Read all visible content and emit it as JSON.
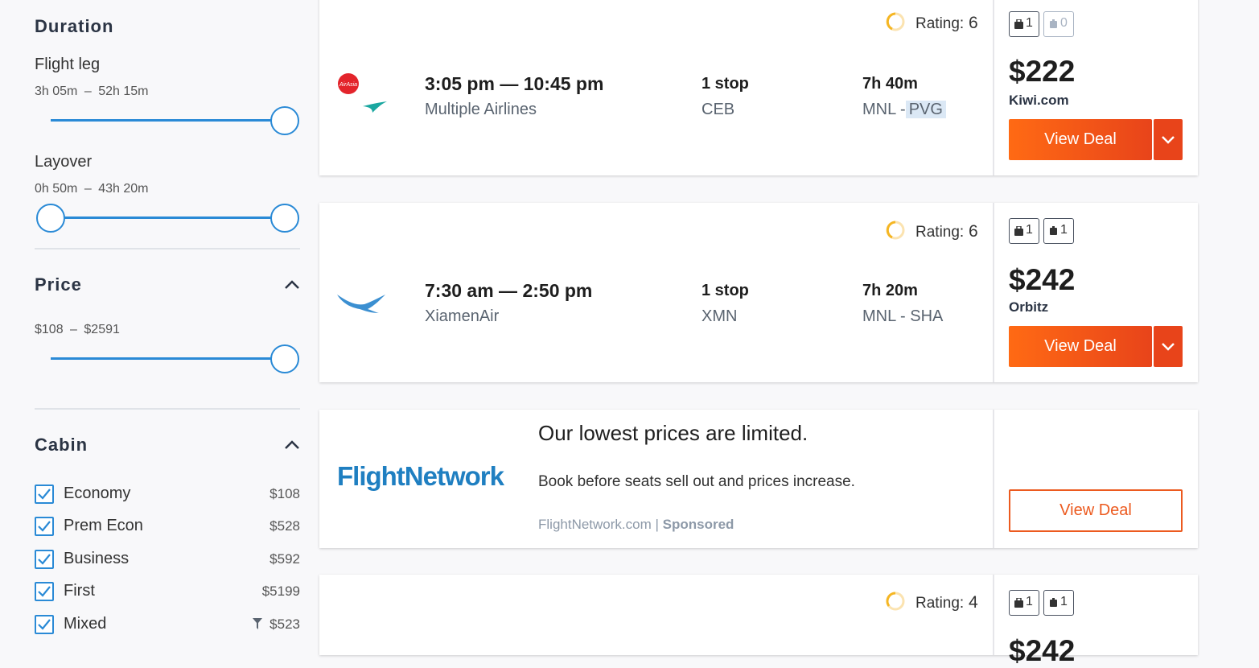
{
  "sidebar": {
    "duration": {
      "title": "Duration",
      "flight_leg": {
        "label": "Flight leg",
        "min": "3h 05m",
        "sep": "–",
        "max": "52h 15m"
      },
      "layover": {
        "label": "Layover",
        "min": "0h 50m",
        "sep": "–",
        "max": "43h 20m"
      }
    },
    "price": {
      "title": "Price",
      "min": "$108",
      "sep": "–",
      "max": "$2591"
    },
    "cabin": {
      "title": "Cabin",
      "options": [
        {
          "label": "Economy",
          "price": "$108",
          "checked": true
        },
        {
          "label": "Prem Econ",
          "price": "$528",
          "checked": true
        },
        {
          "label": "Business",
          "price": "$592",
          "checked": true
        },
        {
          "label": "First",
          "price": "$5199",
          "checked": true
        },
        {
          "label": "Mixed",
          "price": "$523",
          "checked": true
        }
      ]
    }
  },
  "results": [
    {
      "rating_label": "Rating:",
      "rating": "6",
      "times": "3:05 pm — 10:45 pm",
      "airline": "Multiple Airlines",
      "stops": "1 stop",
      "stop_code": "CEB",
      "duration": "7h 40m",
      "route_from": "MNL -",
      "route_to": "PVG",
      "bags": {
        "carry": "1",
        "checked": "0"
      },
      "price": "$222",
      "provider": "Kiwi.com",
      "deal_label": "View Deal",
      "logo_text": "AirAsia"
    },
    {
      "rating_label": "Rating:",
      "rating": "6",
      "times": "7:30 am — 2:50 pm",
      "airline": "XiamenAir",
      "stops": "1 stop",
      "stop_code": "XMN",
      "duration": "7h 20m",
      "route": "MNL - SHA",
      "bags": {
        "carry": "1",
        "checked": "1"
      },
      "price": "$242",
      "provider": "Orbitz",
      "deal_label": "View Deal"
    },
    {
      "rating_label": "Rating:",
      "rating": "4",
      "bags": {
        "carry": "1",
        "checked": "1"
      },
      "price": "$242"
    }
  ],
  "ad": {
    "logo": "FlightNetwork",
    "title": "Our lowest prices are limited.",
    "text": "Book before seats sell out and prices increase.",
    "source": "FlightNetwork.com |",
    "sponsored": "Sponsored",
    "deal_label": "View Deal"
  },
  "colors": {
    "accent": "#2a8ad6",
    "deal": "#e8441a",
    "rating": "#f5b623"
  }
}
